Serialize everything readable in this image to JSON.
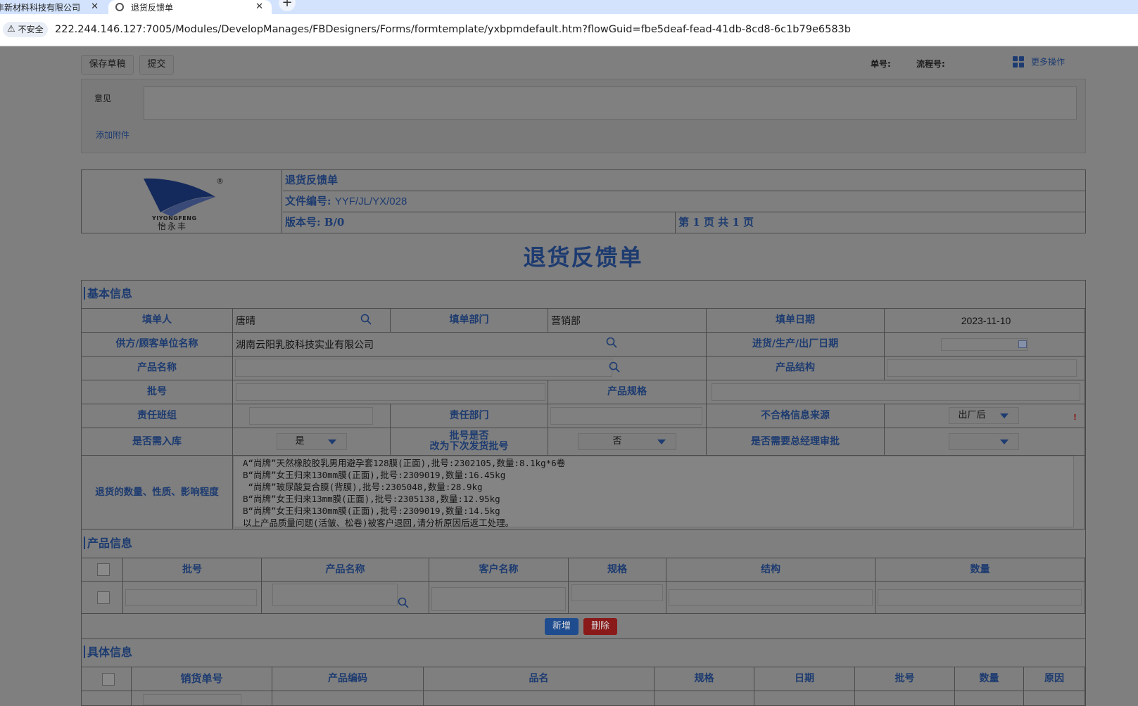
{
  "browser": {
    "tab1_title": "丰新材料科技有限公司",
    "tab2_title": "退货反馈单",
    "insecure_label": "不安全",
    "url": "222.244.146.127:7005/Modules/DevelopManages/FBDesigners/Forms/formtemplate/yxbpmdefault.htm?flowGuid=fbe5deaf-fead-41db-8cd8-6c1b79e6583b"
  },
  "toolbar": {
    "save_draft": "保存草稿",
    "submit": "提交",
    "doc_no_label": "单号:",
    "flow_no_label": "流程号:",
    "more_ops": "更多操作"
  },
  "opinion": {
    "label": "意见",
    "add_attachment": "添加附件"
  },
  "header": {
    "brand": "YIYONGFENG",
    "brand_cn": "怡永丰",
    "form_name": "退货反馈单",
    "file_no_label": "文件编号:",
    "file_no": "YYF/JL/YX/028",
    "version": "版本号: B/0",
    "page": "第 1 页 共 1 页"
  },
  "title": "退货反馈单",
  "basic": {
    "section": "基本信息",
    "filler_label": "填单人",
    "filler": "唐晴",
    "dept_label": "填单部门",
    "dept": "营销部",
    "date_label": "填单日期",
    "date": "2023-11-10",
    "supplier_label": "供方/顾客单位名称",
    "supplier": "湖南云阳乳胶科技实业有限公司",
    "mfg_date_label": "进货/生产/出厂日期",
    "product_name_label": "产品名称",
    "product_struct_label": "产品结构",
    "batch_label": "批号",
    "spec_label": "产品规格",
    "team_label": "责任班组",
    "resp_dept_label": "责任部门",
    "nonconf_label": "不合格信息来源",
    "nonconf_value": "出厂后",
    "need_store_label": "是否需入库",
    "need_store_value": "是",
    "batch_change_label1": "批号是否",
    "batch_change_label2": "改为下次发货批号",
    "batch_change_value": "否",
    "gm_label": "是否需要总经理审批",
    "qty_label": "退货的数量、性质、影响程度",
    "qty_lines": [
      "A“尚牌”天然橡胶胶乳男用避孕套128膜(正面),批号:2302105,数量:8.1kg*6卷",
      "B“尚牌”女王归来130mm膜(正面),批号:2309019,数量:16.45kg",
      " “尚牌”玻尿酸复合膜(背膜),批号:2305048,数量:28.9kg",
      "B“尚牌”女王归来13mm膜(正面),批号:2305138,数量:12.95kg",
      "B“尚牌”女王归来130mm膜(正面),批号:2309019,数量:14.5kg",
      "以上产品质量问题(活皱、松卷)被客户退回,请分析原因后返工处理。"
    ]
  },
  "product": {
    "section": "产品信息",
    "columns": [
      "批号",
      "产品名称",
      "客户名称",
      "规格",
      "结构",
      "数量"
    ],
    "add": "新增",
    "delete": "删除"
  },
  "detail": {
    "section": "具体信息",
    "columns": [
      "销货单号",
      "产品编码",
      "品名",
      "规格",
      "日期",
      "批号",
      "数量",
      "原因"
    ]
  },
  "colors": {
    "label_blue": "#1d3b70",
    "dim_bg": "#7f7f7f",
    "add_btn": "#1f4c8f",
    "del_btn": "#8a1a1a"
  }
}
